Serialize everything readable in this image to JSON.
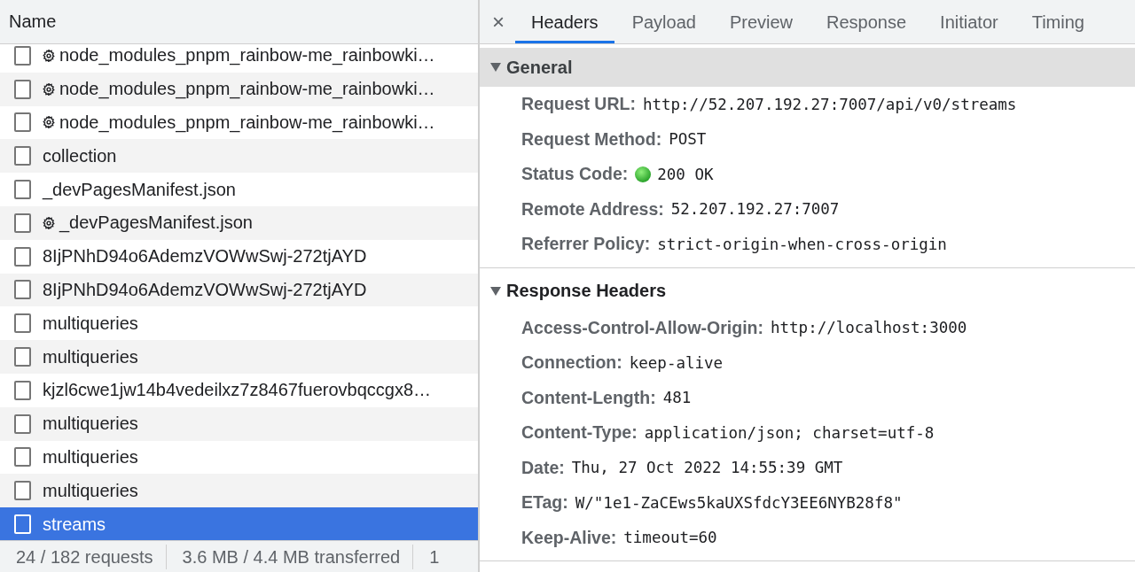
{
  "request_list": {
    "column_header": "Name",
    "rows": [
      {
        "name": "node_modules_pnpm_rainbow-me_rainbowki…",
        "has_gear": true,
        "selected": false,
        "checked": false
      },
      {
        "name": "node_modules_pnpm_rainbow-me_rainbowki…",
        "has_gear": true,
        "selected": false,
        "checked": false
      },
      {
        "name": "node_modules_pnpm_rainbow-me_rainbowki…",
        "has_gear": true,
        "selected": false,
        "checked": false
      },
      {
        "name": "collection",
        "has_gear": false,
        "selected": false,
        "checked": false
      },
      {
        "name": "_devPagesManifest.json",
        "has_gear": false,
        "selected": false,
        "checked": false
      },
      {
        "name": "_devPagesManifest.json",
        "has_gear": true,
        "selected": false,
        "checked": false
      },
      {
        "name": "8IjPNhD94o6AdemzVOWwSwj-272tjAYD",
        "has_gear": false,
        "selected": false,
        "checked": false
      },
      {
        "name": "8IjPNhD94o6AdemzVOWwSwj-272tjAYD",
        "has_gear": false,
        "selected": false,
        "checked": false
      },
      {
        "name": "multiqueries",
        "has_gear": false,
        "selected": false,
        "checked": false
      },
      {
        "name": "multiqueries",
        "has_gear": false,
        "selected": false,
        "checked": false
      },
      {
        "name": "kjzl6cwe1jw14b4vedeilxz7z8467fuerovbqccgx8…",
        "has_gear": false,
        "selected": false,
        "checked": false
      },
      {
        "name": "multiqueries",
        "has_gear": false,
        "selected": false,
        "checked": false
      },
      {
        "name": "multiqueries",
        "has_gear": false,
        "selected": false,
        "checked": false
      },
      {
        "name": "multiqueries",
        "has_gear": false,
        "selected": false,
        "checked": false
      },
      {
        "name": "streams",
        "has_gear": false,
        "selected": true,
        "checked": false
      }
    ]
  },
  "status_bar": [
    "24 / 182 requests",
    "3.6 MB / 4.4 MB transferred",
    "1"
  ],
  "close_button": "×",
  "tabs": [
    {
      "label": "Headers",
      "selected": true
    },
    {
      "label": "Payload",
      "selected": false
    },
    {
      "label": "Preview",
      "selected": false
    },
    {
      "label": "Response",
      "selected": false
    },
    {
      "label": "Initiator",
      "selected": false
    },
    {
      "label": "Timing",
      "selected": false
    }
  ],
  "sections": [
    {
      "title": "General",
      "expanded": true,
      "fields": [
        {
          "name": "Request URL:",
          "value": "http://52.207.192.27:7007/api/v0/streams",
          "kind": "plain"
        },
        {
          "name": "Request Method:",
          "value": "POST",
          "kind": "plain"
        },
        {
          "name": "Status Code:",
          "value": "200 OK",
          "kind": "status"
        },
        {
          "name": "Remote Address:",
          "value": "52.207.192.27:7007",
          "kind": "plain"
        },
        {
          "name": "Referrer Policy:",
          "value": "strict-origin-when-cross-origin",
          "kind": "plain"
        }
      ]
    },
    {
      "title": "Response Headers",
      "expanded": true,
      "fields": [
        {
          "name": "Access-Control-Allow-Origin:",
          "value": "http://localhost:3000",
          "kind": "plain"
        },
        {
          "name": "Connection:",
          "value": "keep-alive",
          "kind": "plain"
        },
        {
          "name": "Content-Length:",
          "value": "481",
          "kind": "plain"
        },
        {
          "name": "Content-Type:",
          "value": "application/json; charset=utf-8",
          "kind": "plain"
        },
        {
          "name": "Date:",
          "value": "Thu, 27 Oct 2022 14:55:39 GMT",
          "kind": "plain"
        },
        {
          "name": "ETag:",
          "value": "W/\"1e1-ZaCEws5kaUXSfdcY3EE6NYB28f8\"",
          "kind": "plain"
        },
        {
          "name": "Keep-Alive:",
          "value": "timeout=60",
          "kind": "plain"
        }
      ]
    }
  ]
}
